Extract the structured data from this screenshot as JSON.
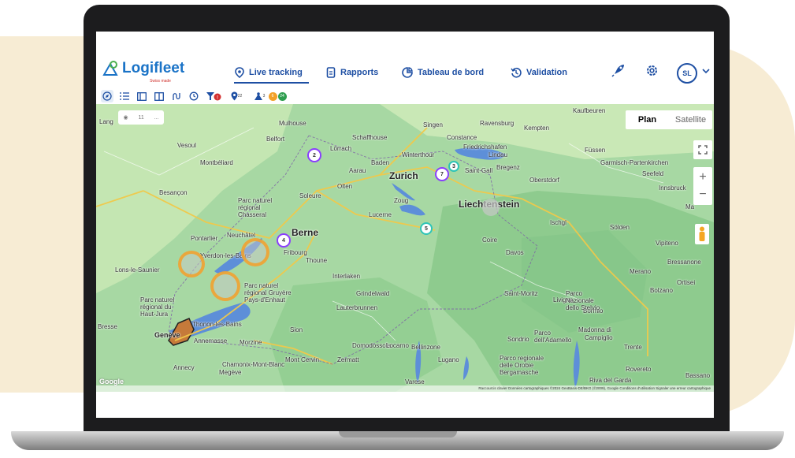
{
  "app": {
    "logo_text": "Logifleet",
    "logo_sub": "Swiss made"
  },
  "nav": {
    "live_tracking": "Live tracking",
    "rapports": "Rapports",
    "tableau_de_bord": "Tableau de bord",
    "validation": "Validation"
  },
  "user": {
    "initials": "SL"
  },
  "toolbar": {
    "pin_count": "22",
    "user_count": "3",
    "badge_orange": "6",
    "badge_green": "24"
  },
  "map_controls": {
    "chip_count": "11",
    "chip_more": "...",
    "plan": "Plan",
    "satellite": "Satellite",
    "zoom_in": "+",
    "zoom_out": "−"
  },
  "map": {
    "cities": [
      {
        "name": "Mulhouse"
      },
      {
        "name": "Lörrach"
      },
      {
        "name": "Belfort"
      },
      {
        "name": "Vesoul"
      },
      {
        "name": "Montbéliard"
      },
      {
        "name": "Besançon"
      },
      {
        "name": "Lang"
      },
      {
        "name": "Pontarlier"
      },
      {
        "name": "Neuchâtel"
      },
      {
        "name": "Yverdon-les-Bains"
      },
      {
        "name": "Lons-le-Saunier"
      },
      {
        "name": "Fribourg"
      },
      {
        "name": "Thoune"
      },
      {
        "name": "Interlaken"
      },
      {
        "name": "Grindelwald"
      },
      {
        "name": "Lauterbrunnen"
      },
      {
        "name": "Thonon-les-Bains"
      },
      {
        "name": "Annemasse"
      },
      {
        "name": "Morzine"
      },
      {
        "name": "Sion"
      },
      {
        "name": "Domodossola"
      },
      {
        "name": "Locarno"
      },
      {
        "name": "Bellinzone"
      },
      {
        "name": "Lugano"
      },
      {
        "name": "Varese"
      },
      {
        "name": "Annecy"
      },
      {
        "name": "Chamonix-Mont-Blanc"
      },
      {
        "name": "Megève"
      },
      {
        "name": "Zermatt"
      },
      {
        "name": "Mont Cervin"
      },
      {
        "name": "Singen"
      },
      {
        "name": "Constance"
      },
      {
        "name": "Schaffhouse"
      },
      {
        "name": "Winterthour"
      },
      {
        "name": "Baden"
      },
      {
        "name": "Aarau"
      },
      {
        "name": "Olten"
      },
      {
        "name": "Soleure"
      },
      {
        "name": "Zoug"
      },
      {
        "name": "Lucerne"
      },
      {
        "name": "Saint-Gall"
      },
      {
        "name": "Bregenz"
      },
      {
        "name": "Lindau"
      },
      {
        "name": "Friedrichshafen"
      },
      {
        "name": "Ravensburg"
      },
      {
        "name": "Kempten"
      },
      {
        "name": "Kaufbeuren"
      },
      {
        "name": "Füssen"
      },
      {
        "name": "Garmisch-Partenkirchen"
      },
      {
        "name": "Oberstdorf"
      },
      {
        "name": "Seefeld"
      },
      {
        "name": "Innsbruck"
      },
      {
        "name": "Ma"
      },
      {
        "name": "Sölden"
      },
      {
        "name": "Vipiteno"
      },
      {
        "name": "Bressanone"
      },
      {
        "name": "Merano"
      },
      {
        "name": "Bolzano"
      },
      {
        "name": "Ortisei"
      },
      {
        "name": "Davos"
      },
      {
        "name": "Coire"
      },
      {
        "name": "Ischgl"
      },
      {
        "name": "Saint-Moritz"
      },
      {
        "name": "Livigno"
      },
      {
        "name": "Bormio"
      },
      {
        "name": "Sondrio"
      },
      {
        "name": "Trente"
      },
      {
        "name": "Riva del Garda"
      },
      {
        "name": "Rovereto"
      },
      {
        "name": "Bassano"
      },
      {
        "name": "Campiglio"
      },
      {
        "name": "Madonna di"
      },
      {
        "name": "Parco Nazionale dello Stelvio"
      },
      {
        "name": "Parco dell'Adamello"
      },
      {
        "name": "Parco regionale delle Orobie Bergamasche"
      },
      {
        "name": "Parc naturel régional Chasseral"
      },
      {
        "name": "Parc naturel régional Gruyère Pays-d'Enhaut"
      },
      {
        "name": "Parc naturel régional du Haut-Jura"
      },
      {
        "name": "Bresse"
      }
    ],
    "major": {
      "zurich": "Zurich",
      "berne": "Berne",
      "geneve": "Genève",
      "liechtenstein": "Liechtenstein"
    },
    "clusters": {
      "c2": "2",
      "c3": "3",
      "c7": "7",
      "c5": "5",
      "c4": "4"
    },
    "google": "Google",
    "attribution": "Raccourcis clavier   Données cartographiques ©2024 GeoBasis-DE/BKG (©2009), Google   Conditions d'utilisation   Signaler une erreur cartographique"
  },
  "colors": {
    "accent": "#1e4fa3",
    "brand": "#1a73c7",
    "cluster_purple": "#8a3ffc",
    "cluster_teal": "#2ec4b6",
    "ring_orange": "#f2a028",
    "background": "#f7ecd4"
  }
}
